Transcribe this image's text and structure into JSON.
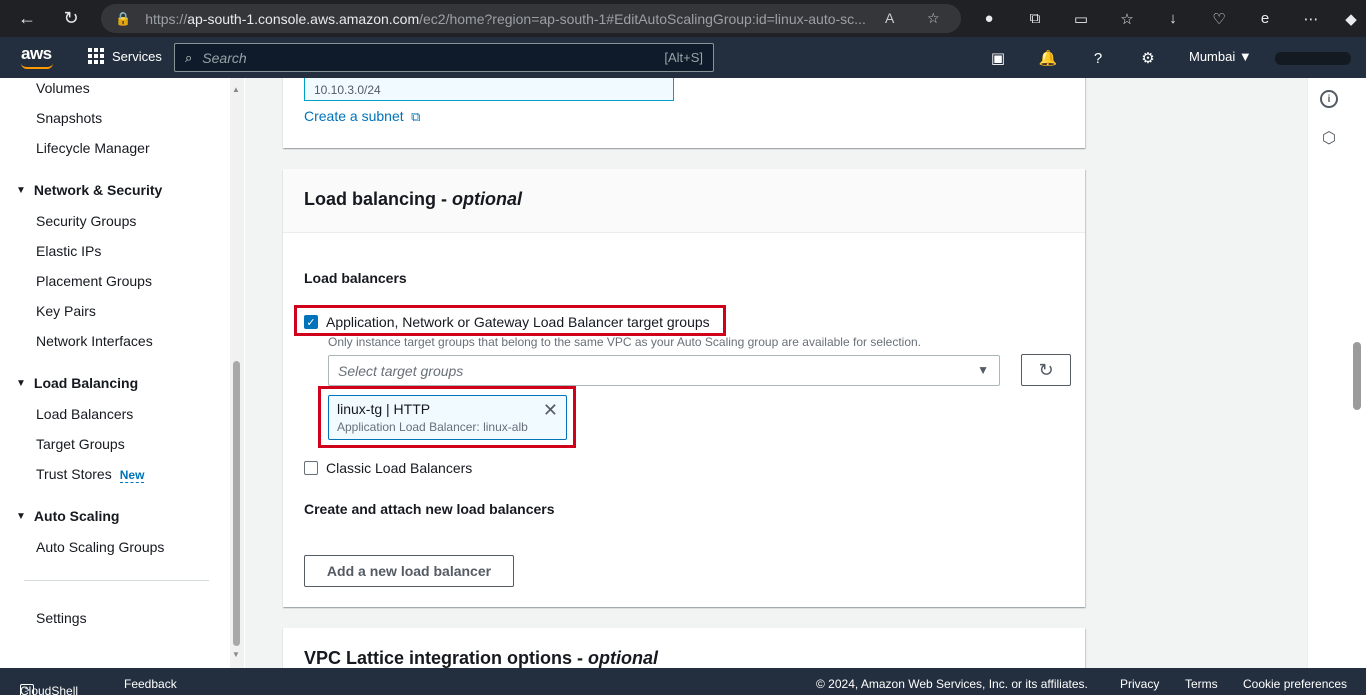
{
  "browser": {
    "url_prefix": "https://",
    "url_host": "ap-south-1.console.aws.amazon.com",
    "url_path": "/ec2/home?region=ap-south-1#EditAutoScalingGroup:id=linux-auto-sc..."
  },
  "topnav": {
    "logo": "aws",
    "services_label": "Services",
    "search_placeholder": "Search",
    "search_shortcut": "[Alt+S]",
    "region": "Mumbai ▼"
  },
  "sidebar": {
    "items_top": [
      "Volumes",
      "Snapshots",
      "Lifecycle Manager"
    ],
    "network_security": {
      "heading": "Network & Security",
      "items": [
        "Security Groups",
        "Elastic IPs",
        "Placement Groups",
        "Key Pairs",
        "Network Interfaces"
      ]
    },
    "load_balancing": {
      "heading": "Load Balancing",
      "items": [
        "Load Balancers",
        "Target Groups",
        "Trust Stores"
      ],
      "new_badge": "New"
    },
    "auto_scaling": {
      "heading": "Auto Scaling",
      "items": [
        "Auto Scaling Groups"
      ]
    },
    "settings": "Settings"
  },
  "subnet_section": {
    "subnet_value": "10.10.3.0/24",
    "create_subnet_link": "Create a subnet"
  },
  "load_balancing_panel": {
    "title": "Load balancing",
    "title_suffix": "optional",
    "dash": " - ",
    "load_balancers_heading": "Load balancers",
    "option_target_groups": "Application, Network or Gateway Load Balancer target groups",
    "option_target_groups_checked": true,
    "target_groups_hint": "Only instance target groups that belong to the same VPC as your Auto Scaling group are available for selection.",
    "select_placeholder": "Select target groups",
    "selected_token": {
      "title": "linux-tg | HTTP",
      "subtitle": "Application Load Balancer: linux-alb"
    },
    "option_classic": "Classic Load Balancers",
    "option_classic_checked": false,
    "create_attach_heading": "Create and attach new load balancers",
    "add_button": "Add a new load balancer"
  },
  "vpc_lattice_panel": {
    "title": "VPC Lattice integration options",
    "title_suffix": "optional",
    "dash": " - "
  },
  "footer": {
    "cloudshell": "CloudShell",
    "feedback": "Feedback",
    "copyright": "© 2024, Amazon Web Services, Inc. or its affiliates.",
    "privacy": "Privacy",
    "terms": "Terms",
    "cookies": "Cookie preferences"
  },
  "colors": {
    "accent": "#0073bb",
    "highlight_box": "#d0021b",
    "nav_bg": "#232f3e"
  }
}
